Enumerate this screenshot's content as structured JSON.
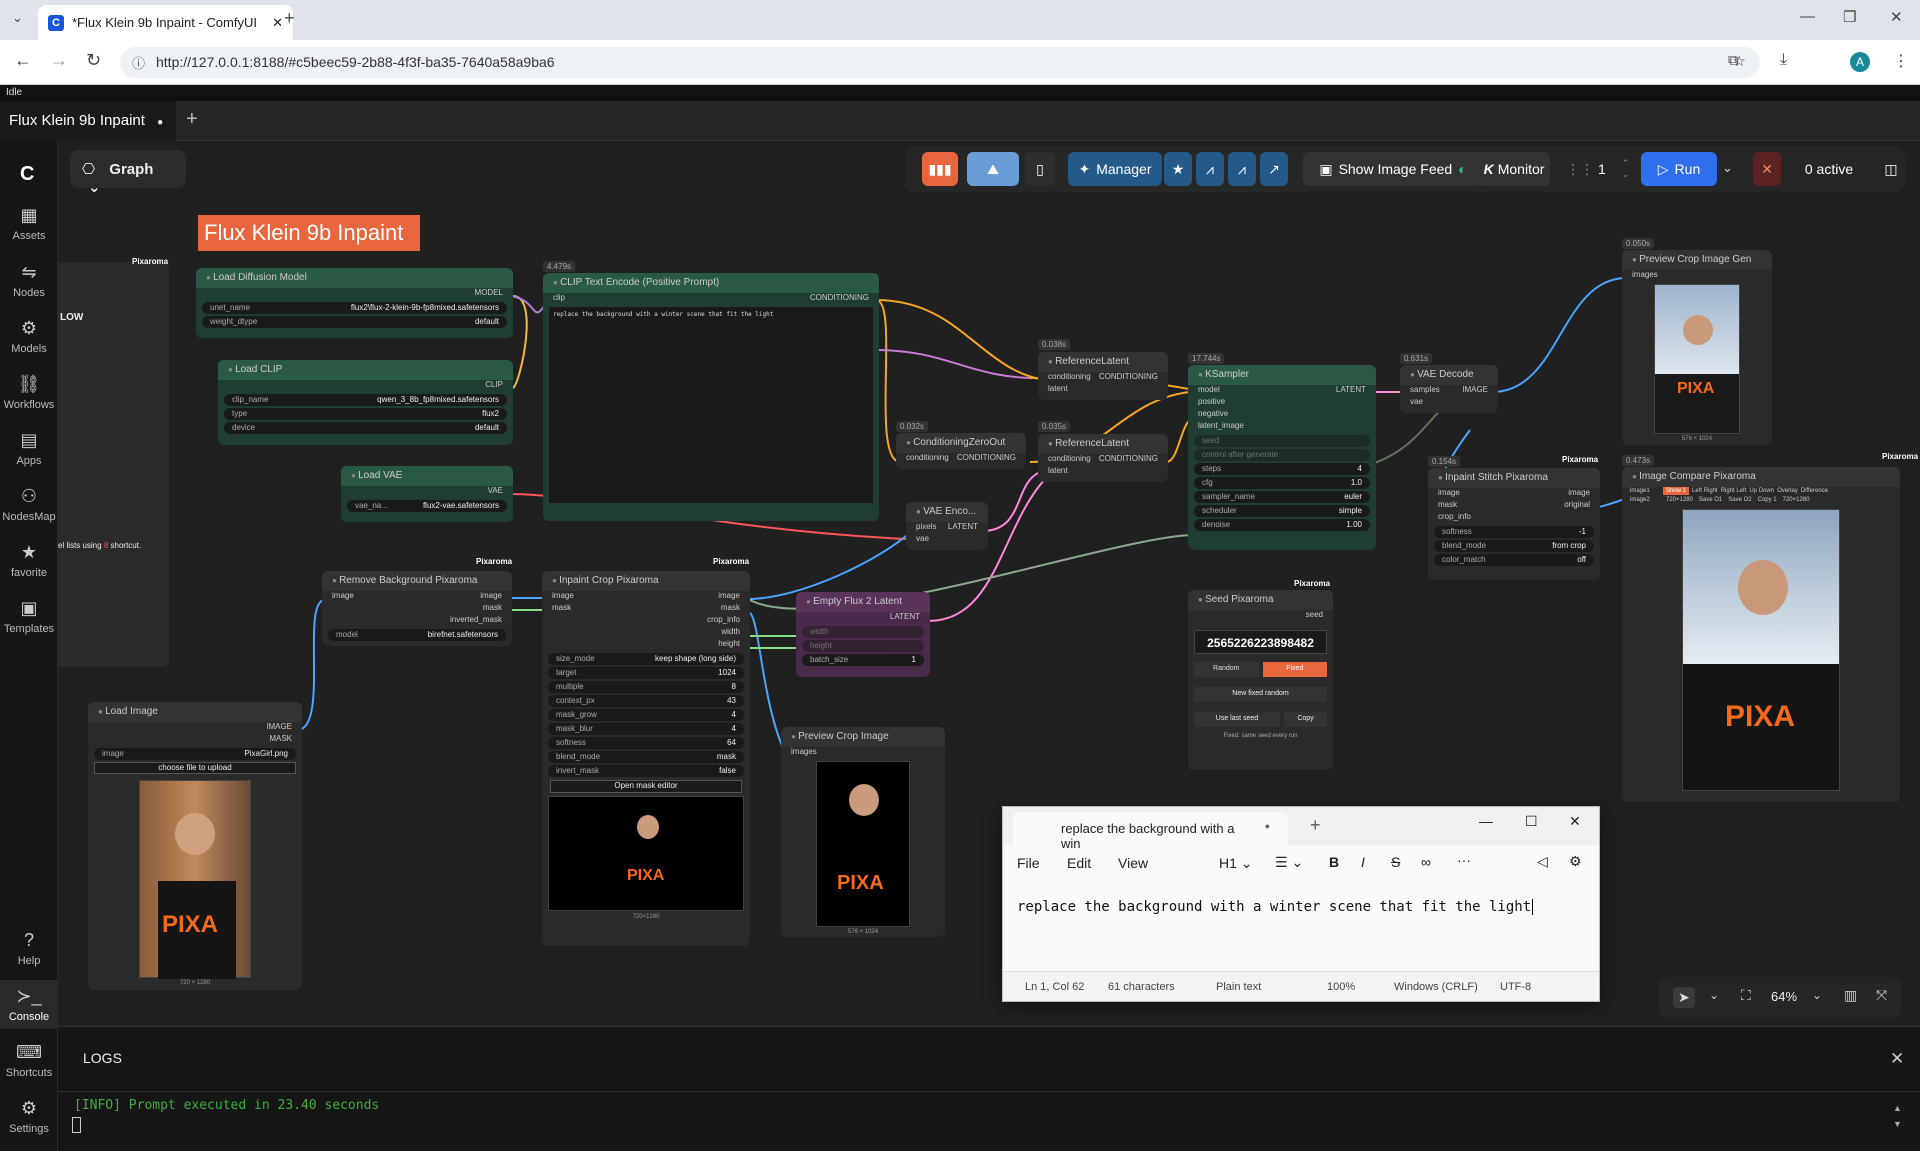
{
  "browser": {
    "tab_title": "*Flux Klein 9b Inpaint - ComfyUI",
    "url": "http://127.0.0.1:8188/#c5beec59-2b88-4f3f-ba35-7640a58a9ba6",
    "profile_initial": "A"
  },
  "app": {
    "status": "Idle",
    "workflow_tab": "Flux Klein 9b Inpaint",
    "view_mode": "Graph"
  },
  "sidebar": {
    "items": [
      {
        "label": "Assets",
        "icon": "assets-icon"
      },
      {
        "label": "Nodes",
        "icon": "nodes-icon"
      },
      {
        "label": "Models",
        "icon": "models-icon"
      },
      {
        "label": "Workflows",
        "icon": "workflows-icon"
      },
      {
        "label": "Apps",
        "icon": "apps-icon"
      },
      {
        "label": "NodesMap",
        "icon": "nodesmap-icon"
      },
      {
        "label": "favorite",
        "icon": "star-icon"
      },
      {
        "label": "Templates",
        "icon": "templates-icon"
      }
    ],
    "bottom": [
      {
        "label": "Help"
      },
      {
        "label": "Console"
      },
      {
        "label": "Shortcuts"
      },
      {
        "label": "Settings"
      }
    ]
  },
  "topbar": {
    "manager_label": "Manager",
    "image_feed_label": "Show Image Feed",
    "monitor_label": "Monitor",
    "batch_count": "1",
    "run_label": "Run",
    "active_label": "0 active"
  },
  "canvas": {
    "group_title": "Flux Klein 9b Inpaint",
    "partial_panel": {
      "label": "LOW",
      "hint": "el lists using",
      "hint_key": "8",
      "hint_end": "shortcut."
    },
    "pixaroma_badge": "Pixaroma"
  },
  "nodes": {
    "load_diffusion": {
      "title": "Load Diffusion Model",
      "out": "MODEL",
      "unet_name_label": "unet_name",
      "unet_name": "flux2\\flux-2-klein-9b-fp8mixed.safetensors",
      "weight_dtype_label": "weight_dtype",
      "weight_dtype": "default"
    },
    "load_clip": {
      "title": "Load CLIP",
      "out": "CLIP",
      "clip_name_label": "clip_name",
      "clip_name": "qwen_3_8b_fp8mixed.safetensors",
      "type_label": "type",
      "type": "flux2",
      "device_label": "device",
      "device": "default"
    },
    "load_vae": {
      "title": "Load VAE",
      "out": "VAE",
      "vae_name_label": "vae_na...",
      "vae_name": "flux2-vae.safetensors"
    },
    "clip_text": {
      "timing": "4.479s",
      "title": "CLIP Text Encode (Positive Prompt)",
      "in": "clip",
      "out": "CONDITIONING",
      "text": "replace the background with a winter scene that fit the light"
    },
    "ref_latent_1": {
      "timing": "0.038s",
      "title": "ReferenceLatent",
      "in1": "conditioning",
      "out": "CONDITIONING",
      "in2": "latent"
    },
    "ref_latent_2": {
      "timing": "0.035s",
      "title": "ReferenceLatent",
      "in1": "conditioning",
      "out": "CONDITIONING",
      "in2": "latent"
    },
    "cond_zero": {
      "timing": "0.032s",
      "title": "ConditioningZeroOut",
      "in": "conditioning",
      "out": "CONDITIONING"
    },
    "vae_encode": {
      "title": "VAE Enco...",
      "in1": "pixels",
      "in2": "vae",
      "out": "LATENT"
    },
    "ksampler": {
      "timing": "17.744s",
      "title": "KSampler",
      "in": [
        "model",
        "positive",
        "negative",
        "latent_image"
      ],
      "out": "LATENT",
      "seed_label": "seed",
      "control_label": "control after generate",
      "steps_label": "steps",
      "steps": "4",
      "cfg_label": "cfg",
      "cfg": "1.0",
      "sampler_label": "sampler_name",
      "sampler": "euler",
      "scheduler_label": "scheduler",
      "scheduler": "simple",
      "denoise_label": "denoise",
      "denoise": "1.00"
    },
    "vae_decode": {
      "timing": "0.631s",
      "title": "VAE Decode",
      "in1": "samples",
      "in2": "vae",
      "out": "IMAGE"
    },
    "preview_gen": {
      "timing": "0.050s",
      "title": "Preview Crop Image Gen",
      "in": "images",
      "caption": "576 × 1024"
    },
    "stitch": {
      "timing": "0.154s",
      "title": "Inpaint Stitch Pixaroma",
      "in": [
        "image",
        "mask",
        "crop_info"
      ],
      "out": [
        "image",
        "original"
      ],
      "softness_label": "softness",
      "softness": "-1",
      "blend_label": "blend_mode",
      "blend": "from crop",
      "color_label": "color_match",
      "color": "off"
    },
    "compare": {
      "timing": "0.473s",
      "title": "Image Compare Pixaroma",
      "in": [
        "image1",
        "image2"
      ],
      "tabs": [
        "Show 1",
        "Left Right",
        "Right Left",
        "Up Down",
        "Overlay",
        "Difference"
      ],
      "size1": "720×1280",
      "save1": "Save O1",
      "save2": "Save O2",
      "copy1": "Copy 1",
      "size2": "720×1280"
    },
    "remove_bg": {
      "title": "Remove Background Pixaroma",
      "in": "image",
      "out": [
        "image",
        "mask",
        "inverted_mask"
      ],
      "model_label": "model",
      "model": "birefnet.safetensors"
    },
    "inpaint_crop": {
      "title": "Inpaint Crop Pixaroma",
      "in": [
        "image",
        "mask"
      ],
      "out": [
        "image",
        "mask",
        "crop_info",
        "width",
        "height"
      ],
      "widgets": [
        [
          "size_mode",
          "keep shape (long side)"
        ],
        [
          "target",
          "1024"
        ],
        [
          "multiple",
          "8"
        ],
        [
          "context_px",
          "43"
        ],
        [
          "mask_grow",
          "4"
        ],
        [
          "mask_blur",
          "4"
        ],
        [
          "softness",
          "64"
        ],
        [
          "blend_mode",
          "mask"
        ],
        [
          "invert_mask",
          "false"
        ]
      ],
      "button": "Open mask editor",
      "caption": "720×1280"
    },
    "empty_latent": {
      "title": "Empty Flux 2 Latent",
      "out": "LATENT",
      "width_label": "width",
      "height_label": "height",
      "batch_label": "batch_size",
      "batch": "1"
    },
    "preview_crop": {
      "title": "Preview Crop Image",
      "in": "images",
      "caption": "576 × 1024"
    },
    "seed": {
      "title": "Seed Pixaroma",
      "out": "seed",
      "value": "2565226223898482",
      "random": "Random",
      "fixed": "Fixed",
      "new_fixed": "New fixed random",
      "use_last": "Use last seed",
      "copy": "Copy",
      "hint": "Fixed: same seed every run"
    },
    "load_image": {
      "title": "Load Image",
      "out1": "IMAGE",
      "out2": "MASK",
      "image_label": "image",
      "image": "PixaGirl.png",
      "upload": "choose file to upload",
      "caption": "720 × 1280"
    }
  },
  "notepad": {
    "tab_title": "replace the background with a win",
    "menu": [
      "File",
      "Edit",
      "View"
    ],
    "heading": "H1",
    "content": "replace the background with a winter scene that fit the light",
    "status": {
      "position": "Ln 1, Col 62",
      "chars": "61 characters",
      "format": "Plain text",
      "zoom": "100%",
      "eol": "Windows (CRLF)",
      "encoding": "UTF-8"
    }
  },
  "zoom": {
    "level": "64%"
  },
  "logs": {
    "title": "LOGS",
    "line": "[INFO] Prompt executed in 23.40 seconds"
  },
  "colors": {
    "accent": "#e8663d",
    "run": "#2f6fed",
    "node_green": "#1f3d30",
    "log_green": "#3fae3f"
  }
}
